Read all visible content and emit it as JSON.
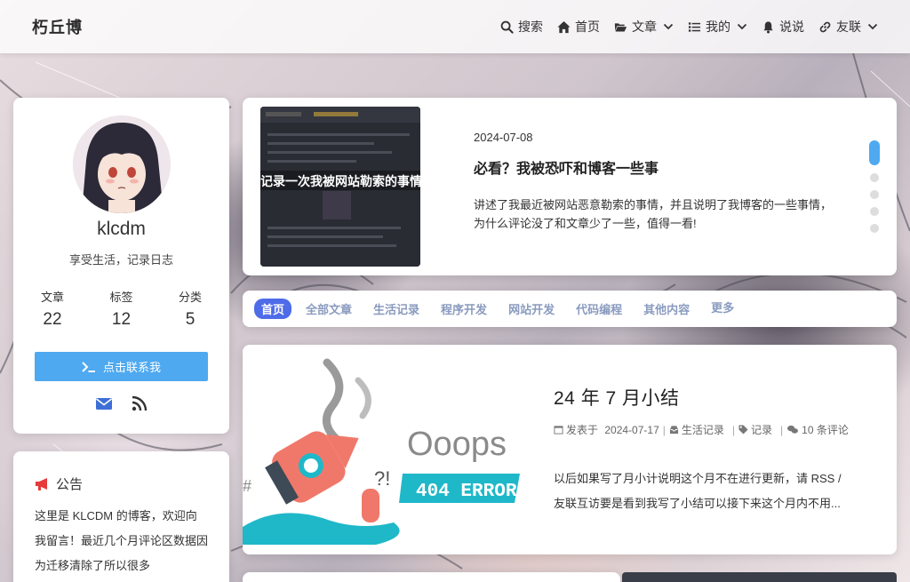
{
  "header": {
    "brand": "朽丘博",
    "nav": [
      {
        "label": "搜索",
        "icon": "search-icon"
      },
      {
        "label": "首页",
        "icon": "home-icon"
      },
      {
        "label": "文章",
        "icon": "folder-icon",
        "dropdown": true
      },
      {
        "label": "我的",
        "icon": "list-icon",
        "dropdown": true
      },
      {
        "label": "说说",
        "icon": "bell-icon"
      },
      {
        "label": "友联",
        "icon": "link-icon",
        "dropdown": true
      }
    ]
  },
  "profile": {
    "name": "klcdm",
    "bio": "享受生活，记录日志",
    "stats": [
      {
        "label": "文章",
        "value": "22"
      },
      {
        "label": "标签",
        "value": "12"
      },
      {
        "label": "分类",
        "value": "5"
      }
    ],
    "contact_label": "点击联系我"
  },
  "notice": {
    "title": "公告",
    "text": "这里是 KLCDM 的博客，欢迎向我留言！最近几个月评论区数据因为迁移清除了所以很多"
  },
  "featured": {
    "image_caption": "记录一次我被网站勒索的事情",
    "date": "2024-07-08",
    "title": "必看？我被恐吓和博客一些事",
    "description": "讲述了我最近被网站恶意勒索的事情，并且说明了我博客的一些事情，为什么评论没了和文章少了一些，值得一看!",
    "slides": 5,
    "active_slide": 0
  },
  "tabs": [
    "首页",
    "全部文章",
    "生活记录",
    "程序开发",
    "网站开发",
    "代码编程",
    "其他内容",
    "更多"
  ],
  "post": {
    "image_text_1": "Ooops",
    "image_text_2": "404 ERROR",
    "title": "24 年 7 月小结",
    "meta_prefix": "发表于",
    "date": "2024-07-17",
    "category": "生活记录",
    "tag": "记录",
    "comments": "10 条评论",
    "excerpt_line1": "以后如果写了月小计说明这个月不在进行更新，请 RSS /",
    "excerpt_line2": "友联互访要是看到我写了小结可以接下来这个月内不用..."
  },
  "colors": {
    "accent": "#4ea9f0",
    "tab_active": "#4e6be8",
    "tab_text": "#8a9bbf",
    "notice_icon": "#e63b3b",
    "error_teal": "#1fb8c9",
    "rocket": "#f0786a"
  }
}
